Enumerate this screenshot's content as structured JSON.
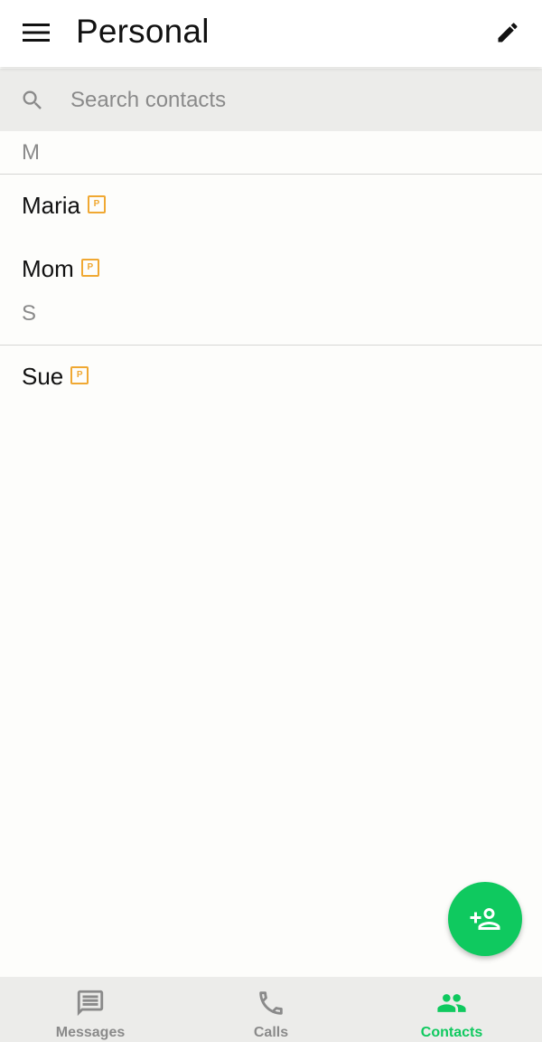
{
  "header": {
    "title": "Personal",
    "menu_icon": "hamburger-menu-icon",
    "edit_icon": "pencil-icon"
  },
  "search": {
    "placeholder": "Search contacts",
    "value": ""
  },
  "sections": [
    {
      "letter": "M",
      "contacts": [
        {
          "name": "Maria",
          "badge": "P"
        },
        {
          "name": "Mom",
          "badge": "P"
        }
      ]
    },
    {
      "letter": "S",
      "contacts": [
        {
          "name": "Sue",
          "badge": "P"
        }
      ]
    }
  ],
  "fab": {
    "icon": "add-contact-icon"
  },
  "nav": {
    "tabs": [
      {
        "label": "Messages",
        "icon": "message-icon",
        "active": false
      },
      {
        "label": "Calls",
        "icon": "phone-icon",
        "active": false
      },
      {
        "label": "Contacts",
        "icon": "contacts-icon",
        "active": true
      }
    ]
  },
  "colors": {
    "accent": "#0fc95f",
    "badge": "#f0a832",
    "inactive": "#8a8a8a"
  }
}
